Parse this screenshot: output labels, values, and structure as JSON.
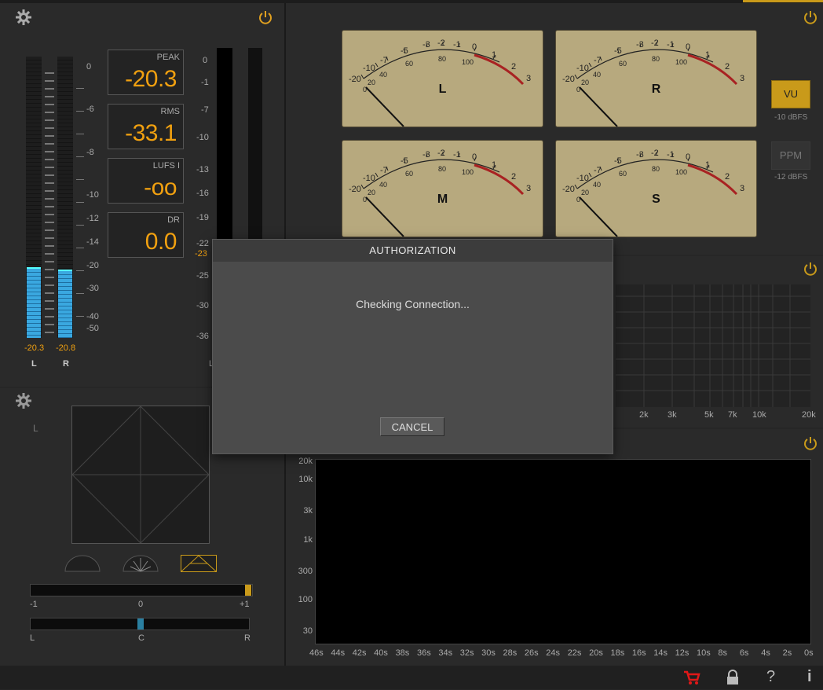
{
  "level_meter": {
    "scale": [
      "0",
      "-6",
      "-8",
      "-10",
      "-12",
      "-14",
      "-20",
      "-30",
      "-40",
      "-50"
    ],
    "left_readout": "-20.3",
    "right_readout": "-20.8",
    "left_label": "L",
    "right_label": "R",
    "left_level_fraction": 0.26,
    "right_level_fraction": 0.25
  },
  "stats": {
    "peak_label": "PEAK",
    "peak_value": "-20.3",
    "rms_label": "RMS",
    "rms_value": "-33.1",
    "lufs_label": "LUFS I",
    "lufs_value": "-oo",
    "dr_label": "DR",
    "dr_value": "0.0"
  },
  "loudness_scale": [
    "0",
    "-1",
    "-7",
    "-10",
    "-13",
    "-16",
    "-19",
    "-22",
    "-25",
    "-30",
    "-36"
  ],
  "loudness_marker": "-23",
  "loudness_partial_label": "L",
  "vu_meters": {
    "scale_top": [
      "-20",
      "-10",
      "-7",
      "-5",
      "-3",
      "-2",
      "-1",
      "0",
      "1",
      "2",
      "3"
    ],
    "scale_bottom": [
      "0",
      "20",
      "40",
      "60",
      "80",
      "100"
    ],
    "channels": [
      "L",
      "R",
      "M",
      "S"
    ]
  },
  "vu_mode": {
    "vu_label": "VU",
    "vu_ref": "-10 dBFS",
    "ppm_label": "PPM",
    "ppm_ref": "-12 dBFS"
  },
  "spectrum": {
    "x_labels": [
      "2k",
      "3k",
      "5k",
      "7k",
      "10k",
      "20k"
    ]
  },
  "spectrogram": {
    "y_labels": [
      "20k",
      "10k",
      "3k",
      "1k",
      "300",
      "100",
      "30"
    ],
    "x_labels": [
      "46s",
      "44s",
      "42s",
      "40s",
      "38s",
      "36s",
      "34s",
      "32s",
      "30s",
      "28s",
      "26s",
      "24s",
      "22s",
      "20s",
      "18s",
      "16s",
      "14s",
      "12s",
      "10s",
      "8s",
      "6s",
      "4s",
      "2s",
      "0s"
    ]
  },
  "stereo": {
    "l_label": "L",
    "correlation": {
      "min": "-1",
      "mid": "0",
      "max": "+1",
      "value": 1.0
    },
    "balance": {
      "left": "L",
      "center": "C",
      "right": "R",
      "value": 0.0
    }
  },
  "dialog": {
    "title": "AUTHORIZATION",
    "message": "Checking Connection...",
    "cancel_label": "CANCEL"
  },
  "footer": {
    "help_label": "?",
    "info_label": "i"
  },
  "colors": {
    "accent": "#f0a010",
    "meter_blue": "#2a9ad8",
    "vu_face": "#b7a97e",
    "cart": "#e01818"
  }
}
